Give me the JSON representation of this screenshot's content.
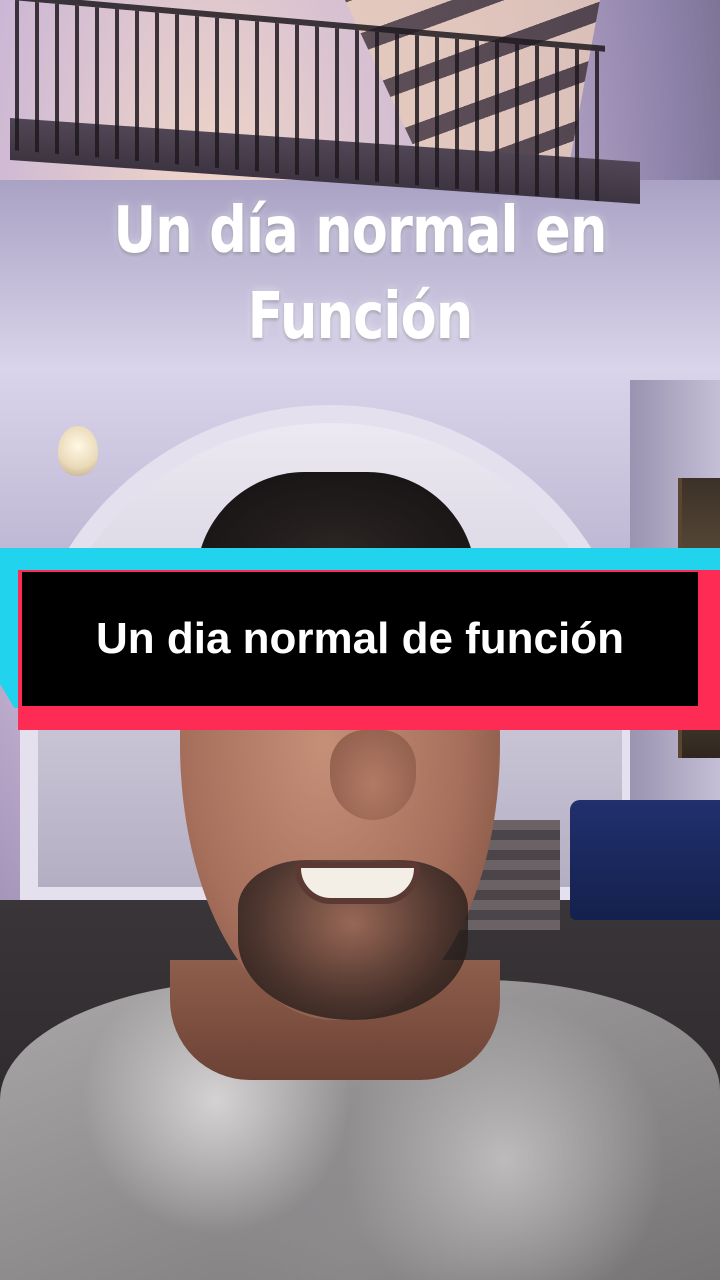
{
  "overlay": {
    "title_line1": "Un día normal en",
    "title_line2": "Función"
  },
  "caption": {
    "text": "Un dia normal de función"
  },
  "colors": {
    "caption_background": "#000000",
    "caption_accent_cyan": "#22d3ee",
    "caption_accent_red": "#fe2c55",
    "text": "#ffffff"
  }
}
